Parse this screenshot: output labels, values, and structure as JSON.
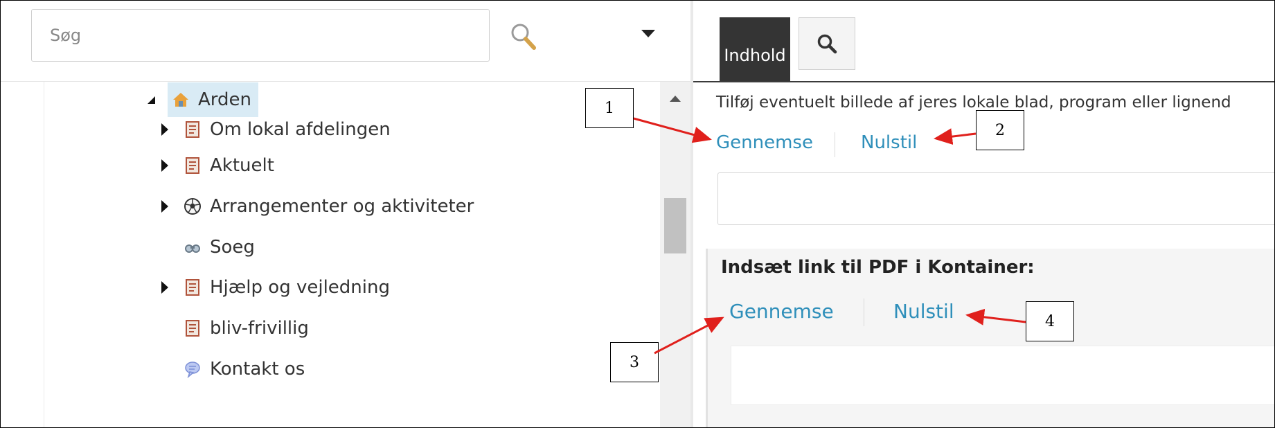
{
  "search": {
    "placeholder": "Søg"
  },
  "tree": {
    "root": {
      "label": "Arden",
      "icon": "home-icon"
    },
    "items": [
      {
        "label": "Om lokal afdelingen",
        "icon": "page-icon",
        "expandable": true
      },
      {
        "label": "Aktuelt",
        "icon": "page-icon",
        "expandable": true
      },
      {
        "label": "Arrangementer og aktiviteter",
        "icon": "soccer-ball-icon",
        "expandable": true
      },
      {
        "label": "Soeg",
        "icon": "binoculars-icon",
        "expandable": false
      },
      {
        "label": "Hjælp og vejledning",
        "icon": "page-icon",
        "expandable": true
      },
      {
        "label": "bliv-frivillig",
        "icon": "page-icon",
        "expandable": false
      },
      {
        "label": "Kontakt os",
        "icon": "speech-bubble-icon",
        "expandable": false
      }
    ]
  },
  "tabs": {
    "active_label": "Indhold",
    "search_tab_icon": "search-icon"
  },
  "content": {
    "hint": "Tilføj eventuelt billede af jeres lokale blad, program eller lignend",
    "browse_label_1": "Gennemse",
    "reset_label_1": "Nulstil",
    "pdf_section_title": "Indsæt link til PDF i Kontainer:",
    "browse_label_2": "Gennemse",
    "reset_label_2": "Nulstil"
  },
  "annotations": [
    "1",
    "2",
    "3",
    "4"
  ],
  "colors": {
    "link": "#2f8fba",
    "tab_active_bg": "#343434",
    "selected_row_bg": "#d9ebf5",
    "arrow": "#e0201c"
  }
}
